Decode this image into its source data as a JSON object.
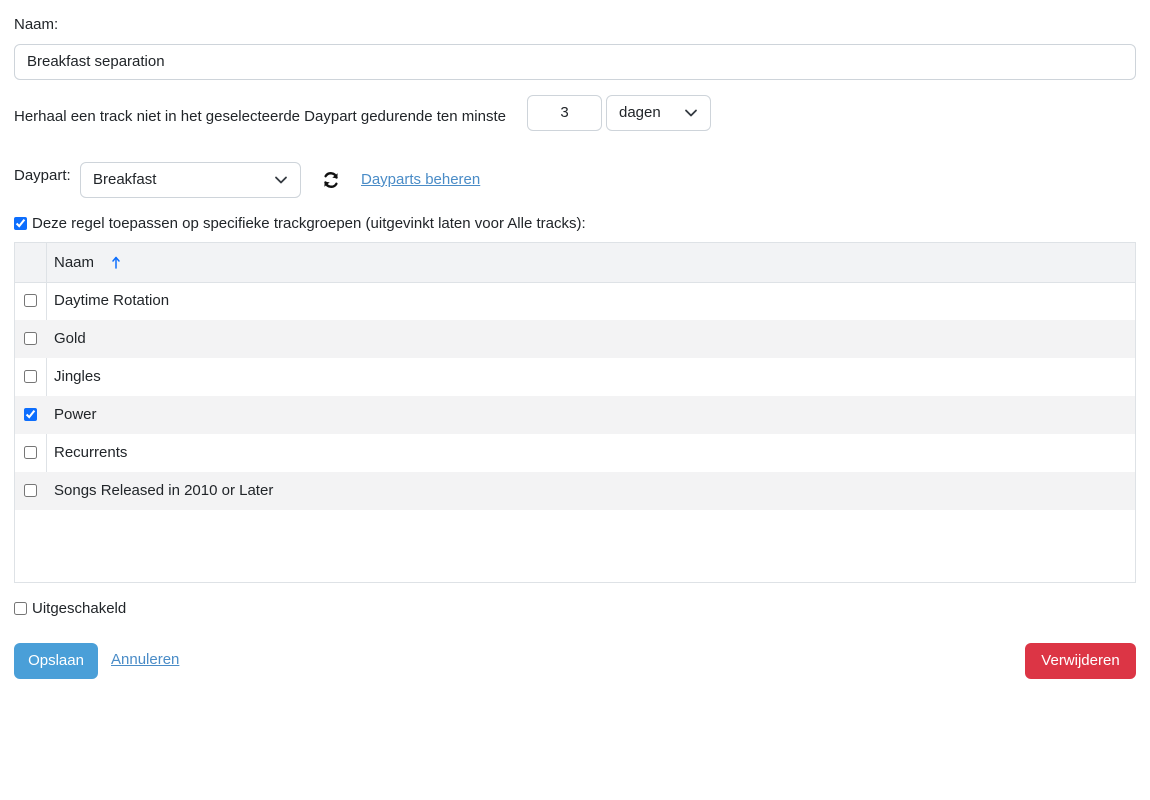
{
  "form": {
    "name_label": "Naam:",
    "name_value": "Breakfast separation",
    "repeat_label": "Herhaal een track niet in het geselecteerde Daypart gedurende ten minste",
    "repeat_value": "3",
    "unit_selected": "dagen",
    "daypart_label": "Daypart:",
    "daypart_selected": "Breakfast",
    "manage_link": "Dayparts beheren",
    "apply_label": "Deze regel toepassen op specifieke trackgroepen (uitgevinkt laten voor Alle tracks):",
    "apply_checked": true,
    "disabled_label": "Uitgeschakeld",
    "disabled_checked": false
  },
  "table": {
    "column_header": "Naam",
    "sort_icon": "arrow-up-icon",
    "rows": [
      {
        "label": "Daytime Rotation",
        "checked": false
      },
      {
        "label": "Gold",
        "checked": false
      },
      {
        "label": "Jingles",
        "checked": false
      },
      {
        "label": "Power",
        "checked": true
      },
      {
        "label": "Recurrents",
        "checked": false
      },
      {
        "label": "Songs Released in 2010 or Later",
        "checked": false
      }
    ]
  },
  "actions": {
    "save_label": "Opslaan",
    "cancel_label": "Annuleren",
    "delete_label": "Verwijderen"
  },
  "colors": {
    "save_button": "#4a9fd8",
    "delete_button": "#dc3545",
    "link": "#4a8cc7",
    "sort_arrow": "#0d6efd"
  },
  "icons": {
    "refresh": "refresh-icon",
    "select_chevron": "chevron-down-icon"
  }
}
